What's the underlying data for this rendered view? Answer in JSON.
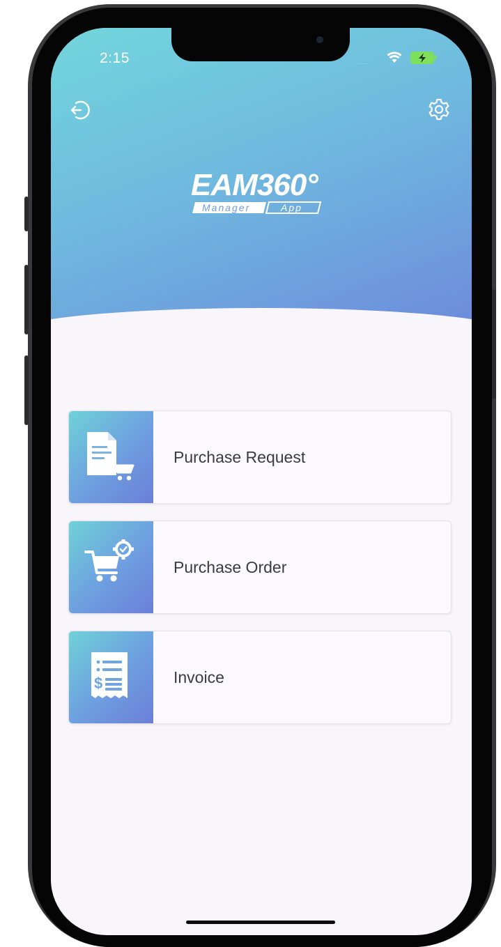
{
  "status_bar": {
    "time": "2:15",
    "signal": "....",
    "wifi_icon": "wifi-icon",
    "battery_icon": "battery-charging-icon"
  },
  "header": {
    "logout_icon": "logout-icon",
    "settings_icon": "gear-icon",
    "logo": {
      "brand": "EAM360°",
      "left_tag": "Manager",
      "right_tag": "App"
    }
  },
  "menu": {
    "items": [
      {
        "label": "Purchase Request",
        "icon": "purchase-request-icon"
      },
      {
        "label": "Purchase Order",
        "icon": "purchase-order-icon"
      },
      {
        "label": "Invoice",
        "icon": "invoice-icon"
      }
    ]
  },
  "colors": {
    "gradient_start": "#72d6dc",
    "gradient_end": "#6d86dc",
    "background": "#f8f5fb",
    "text": "#3b3b40"
  }
}
